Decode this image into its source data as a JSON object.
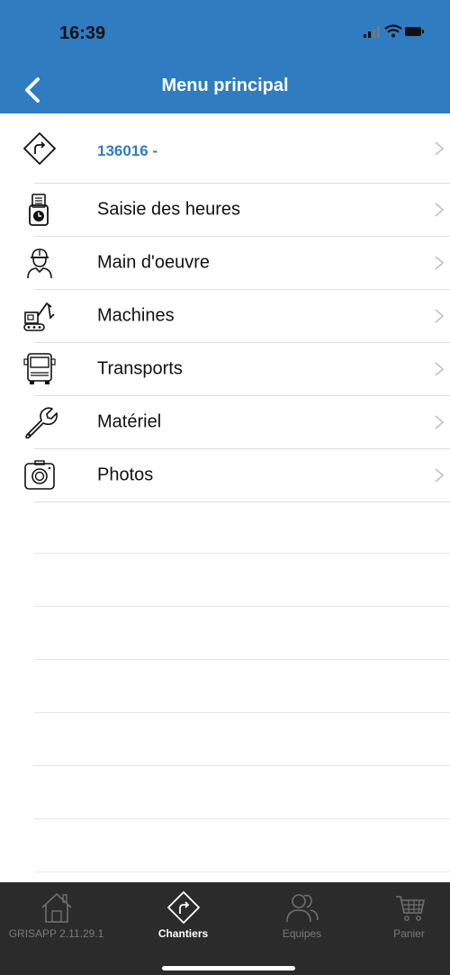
{
  "status_bar": {
    "time": "16:39"
  },
  "nav": {
    "title": "Menu principal",
    "back_icon": "chevron-left-icon"
  },
  "menu": {
    "items": [
      {
        "label": "136016 -",
        "icon": "direction-sign-icon"
      },
      {
        "label": "Saisie des heures",
        "icon": "time-clock-icon"
      },
      {
        "label": "Main d'oeuvre",
        "icon": "worker-icon"
      },
      {
        "label": "Machines",
        "icon": "excavator-icon"
      },
      {
        "label": "Transports",
        "icon": "truck-icon"
      },
      {
        "label": "Matériel",
        "icon": "wrench-icon"
      },
      {
        "label": "Photos",
        "icon": "camera-icon"
      }
    ]
  },
  "tabs": [
    {
      "label": "GRISAPP 2.11.29.1",
      "icon": "home-icon",
      "active": false
    },
    {
      "label": "Chantiers",
      "icon": "direction-sign-icon",
      "active": true
    },
    {
      "label": "Equipes",
      "icon": "team-icon",
      "active": false
    },
    {
      "label": "Panier",
      "icon": "cart-icon",
      "active": false
    }
  ],
  "colors": {
    "header": "#2f7cc1",
    "project_label": "#2f7cc1",
    "tab_bar": "#2b2b2b"
  }
}
